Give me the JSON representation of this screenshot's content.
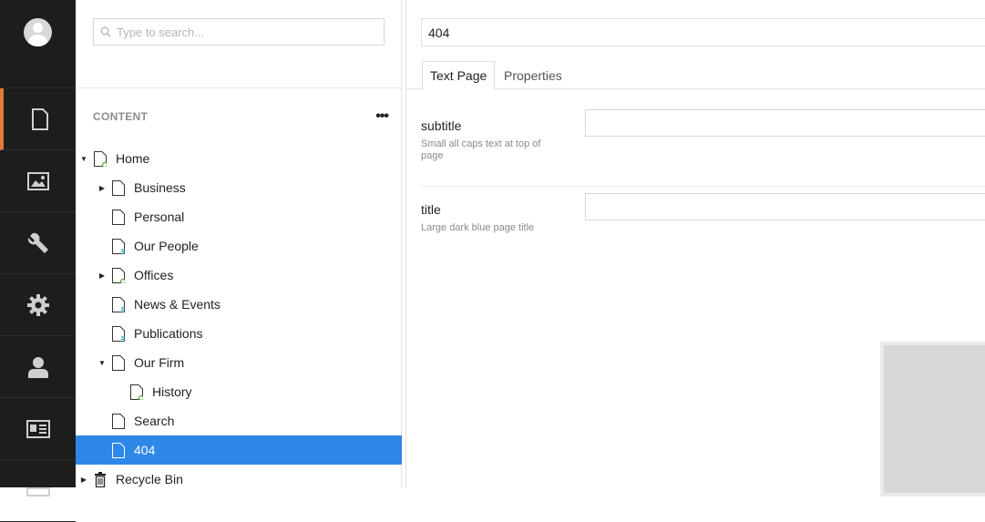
{
  "search": {
    "placeholder": "Type to search..."
  },
  "sections": [
    {
      "icon": "document-icon",
      "active": true
    },
    {
      "icon": "image-icon"
    },
    {
      "icon": "wrench-icon"
    },
    {
      "icon": "gear-icon"
    },
    {
      "icon": "user-icon"
    },
    {
      "icon": "id-card-icon"
    },
    {
      "icon": "form-icon"
    }
  ],
  "tree": {
    "header": "CONTENT",
    "more": "•••",
    "nodes": [
      {
        "label": "Home"
      },
      {
        "label": "Business"
      },
      {
        "label": "Personal"
      },
      {
        "label": "Our People"
      },
      {
        "label": "Offices"
      },
      {
        "label": "News & Events"
      },
      {
        "label": "Publications"
      },
      {
        "label": "Our Firm"
      },
      {
        "label": "History"
      },
      {
        "label": "Search"
      },
      {
        "label": "404"
      },
      {
        "label": "Recycle Bin"
      }
    ]
  },
  "editor": {
    "name": "404",
    "tabs": [
      "Text Page",
      "Properties"
    ],
    "properties": [
      {
        "name": "subtitle",
        "description": "Small all caps text at top of page",
        "value": ""
      },
      {
        "name": "title",
        "description": "Large dark blue page title",
        "value": ""
      }
    ]
  },
  "colors": {
    "accent": "#e07a3b",
    "selected": "#2e88e8",
    "appbar": "#1d1d1d"
  }
}
